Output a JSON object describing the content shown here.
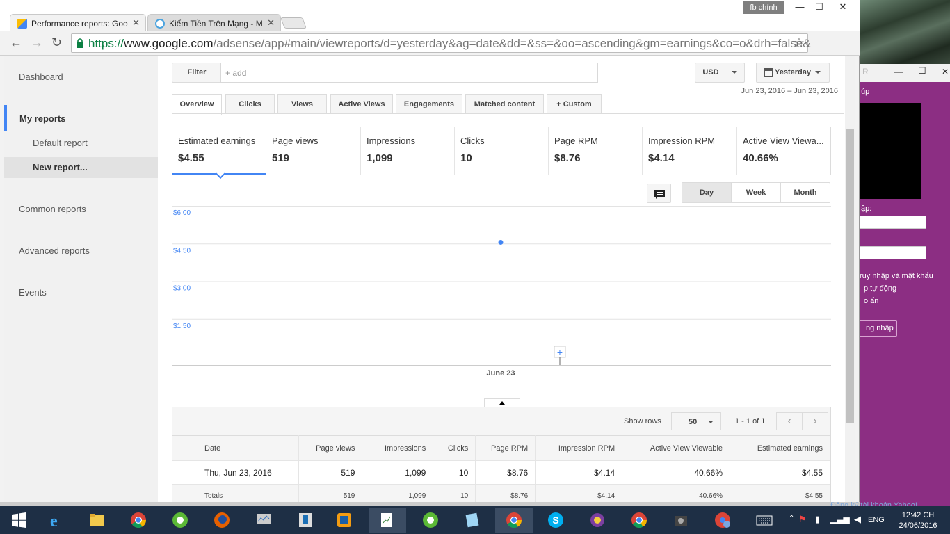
{
  "browser": {
    "tabs": [
      {
        "title": "Performance reports: Goo",
        "active": true
      },
      {
        "title": "Kiếm Tiền Trên Mạng - M",
        "active": false
      }
    ],
    "profile_name": "fb chính",
    "url_scheme": "https://",
    "url_host": "www.google.com",
    "url_path": "/adsense/app#main/viewreports/d=yesterday&ag=date&dd=&ss=&oo=ascending&gm=earnings&co=o&drh=false&"
  },
  "sidebar": {
    "items": [
      {
        "label": "Dashboard"
      },
      {
        "label": "My reports"
      },
      {
        "label": "Default report"
      },
      {
        "label": "New report..."
      },
      {
        "label": "Common reports"
      },
      {
        "label": "Advanced reports"
      },
      {
        "label": "Events"
      }
    ]
  },
  "toolbar": {
    "filter_label": "Filter",
    "filter_placeholder": "+ add",
    "currency": "USD",
    "date_preset": "Yesterday",
    "date_range": "Jun 23, 2016 – Jun 23, 2016"
  },
  "report_tabs": [
    "Overview",
    "Clicks",
    "Views",
    "Active Views",
    "Engagements",
    "Matched content",
    "+ Custom"
  ],
  "scorecards": [
    {
      "label": "Estimated earnings",
      "value": "$4.55"
    },
    {
      "label": "Page views",
      "value": "519"
    },
    {
      "label": "Impressions",
      "value": "1,099"
    },
    {
      "label": "Clicks",
      "value": "10"
    },
    {
      "label": "Page RPM",
      "value": "$8.76"
    },
    {
      "label": "Impression RPM",
      "value": "$4.14"
    },
    {
      "label": "Active View Viewa...",
      "value": "40.66%"
    }
  ],
  "period_buttons": [
    "Day",
    "Week",
    "Month"
  ],
  "chart_data": {
    "type": "scatter",
    "x": [
      "June 23"
    ],
    "series": [
      {
        "values": [
          4.55
        ]
      }
    ],
    "y_ticks": [
      "$6.00",
      "$4.50",
      "$3.00",
      "$1.50"
    ],
    "ylim": [
      0,
      6
    ],
    "grid": true,
    "point_color": "#4285f4"
  },
  "table": {
    "show_rows_label": "Show rows",
    "rows_per_page": "50",
    "range_text": "1 - 1 of 1",
    "columns": [
      "Date",
      "Page views",
      "Impressions",
      "Clicks",
      "Page RPM",
      "Impression RPM",
      "Active View Viewable",
      "Estimated earnings"
    ],
    "rows": [
      [
        "Thu, Jun 23, 2016",
        "519",
        "1,099",
        "10",
        "$8.76",
        "$4.14",
        "40.66%",
        "$4.55"
      ]
    ],
    "totals": [
      "Totals",
      "519",
      "1,099",
      "10",
      "$8.76",
      "$4.14",
      "40.66%",
      "$4.55"
    ]
  },
  "side_window": {
    "texts": [
      "úp",
      "ập:",
      "ruy nhập và mật khẩu",
      "p tự động",
      "o ẩn",
      "ng nhập"
    ],
    "footer": "Đăng ký tài khoản Yahoo!"
  },
  "taskbar": {
    "lang": "ENG",
    "time": "12:42 CH",
    "date": "24/06/2016"
  },
  "colors": {
    "accent": "#4285f4",
    "yahoo": "#8c2e83",
    "taskbar": "#1e2f45"
  }
}
